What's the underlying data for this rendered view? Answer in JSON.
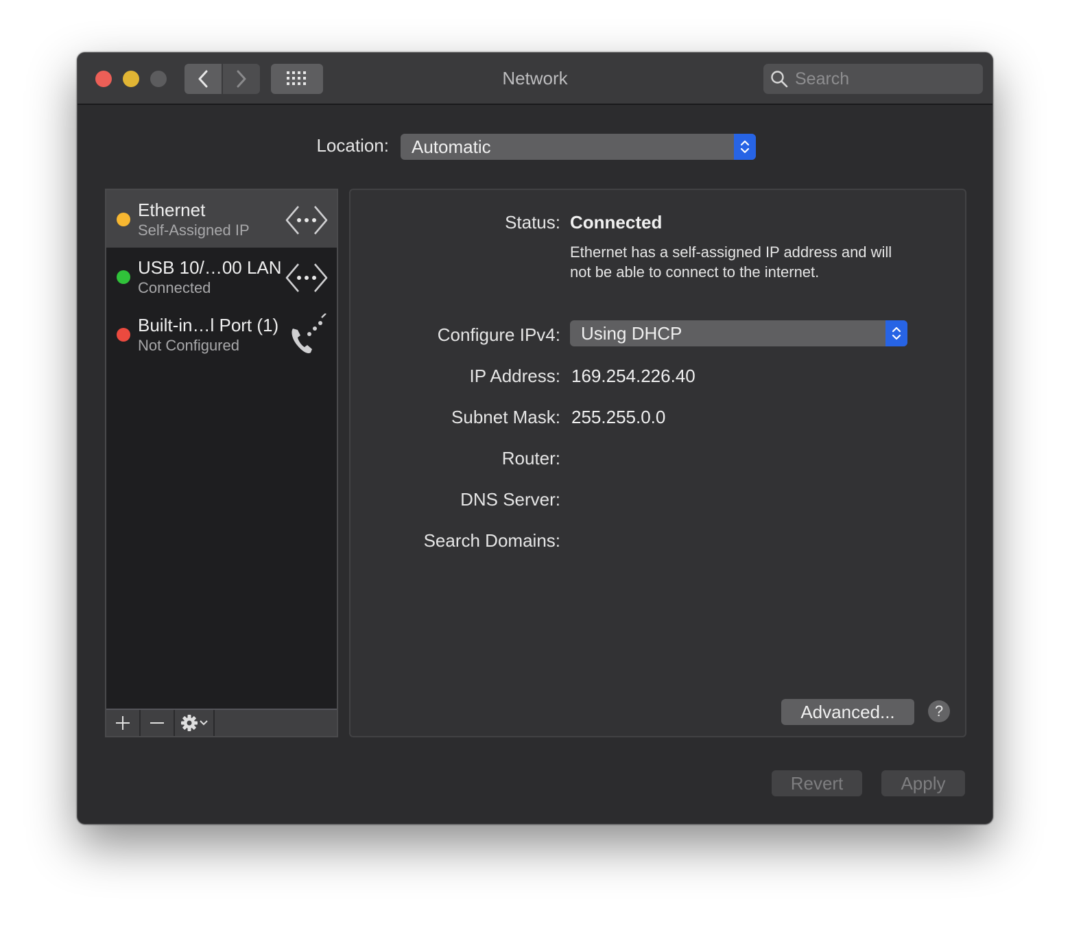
{
  "window": {
    "title": "Network",
    "search_placeholder": "Search"
  },
  "toolbar": {
    "back_icon": "chevron-left-icon",
    "forward_icon": "chevron-right-icon",
    "grid_icon": "show-all-grid-icon"
  },
  "location": {
    "label": "Location:",
    "value": "Automatic"
  },
  "services": [
    {
      "name": "Ethernet",
      "status": "Self-Assigned IP",
      "dot_color": "#f7b731",
      "icon": "ethernet-arrows-icon",
      "selected": true
    },
    {
      "name": "USB 10/…00 LAN",
      "status": "Connected",
      "dot_color": "#30c23a",
      "icon": "ethernet-arrows-icon",
      "selected": false
    },
    {
      "name": "Built-in…l Port (1)",
      "status": "Not Configured",
      "dot_color": "#eb4a3f",
      "icon": "modem-phone-icon",
      "selected": false
    }
  ],
  "sidebar_footer": {
    "add_icon": "plus-icon",
    "remove_icon": "minus-icon",
    "action_icon": "gear-icon"
  },
  "detail": {
    "status_label": "Status:",
    "status_value": "Connected",
    "status_description": "Ethernet has a self-assigned IP address and will not be able to connect to the internet.",
    "configure_label": "Configure IPv4:",
    "configure_value": "Using DHCP",
    "ip_label": "IP Address:",
    "ip_value": "169.254.226.40",
    "subnet_label": "Subnet Mask:",
    "subnet_value": "255.255.0.0",
    "router_label": "Router:",
    "router_value": "",
    "dns_label": "DNS Server:",
    "dns_value": "",
    "search_domains_label": "Search Domains:",
    "search_domains_value": "",
    "advanced_label": "Advanced...",
    "help_label": "?"
  },
  "footer": {
    "revert_label": "Revert",
    "apply_label": "Apply"
  },
  "colors": {
    "accent": "#2764e5",
    "window_bg": "#2c2c2e"
  }
}
